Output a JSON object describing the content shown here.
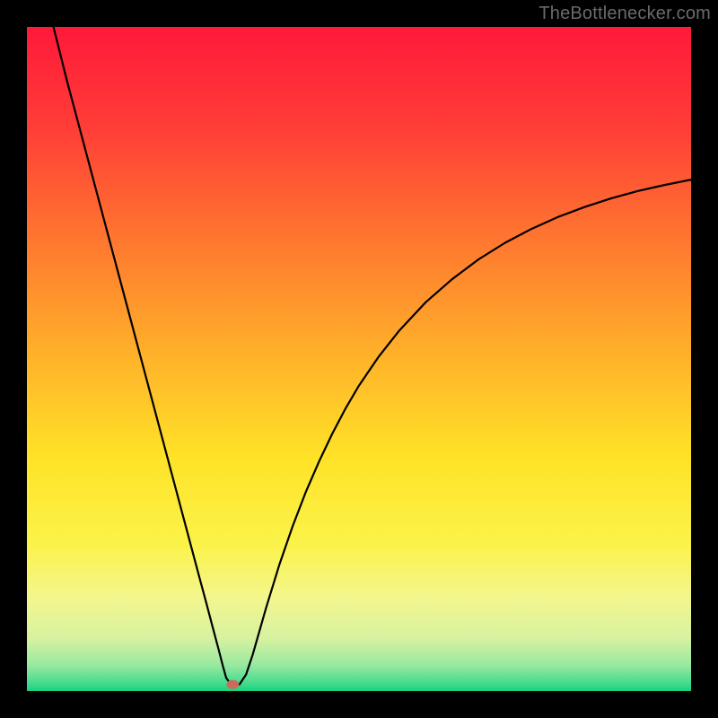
{
  "watermark": "TheBottlenecker.com",
  "chart_data": {
    "type": "line",
    "title": "",
    "xlabel": "",
    "ylabel": "",
    "xlim": [
      0,
      100
    ],
    "ylim": [
      0,
      100
    ],
    "x_min_at": 30,
    "marker": {
      "x": 31,
      "y": 1,
      "color": "#c96a5a",
      "rx": 7,
      "ry": 5
    },
    "grid": false,
    "legend": false,
    "background_gradient": {
      "stops": [
        {
          "offset": 0.0,
          "color": "#ff193a"
        },
        {
          "offset": 0.15,
          "color": "#ff3d37"
        },
        {
          "offset": 0.33,
          "color": "#ff7a2f"
        },
        {
          "offset": 0.5,
          "color": "#ffb329"
        },
        {
          "offset": 0.65,
          "color": "#ffe328"
        },
        {
          "offset": 0.78,
          "color": "#fbf34a"
        },
        {
          "offset": 0.86,
          "color": "#f3f68e"
        },
        {
          "offset": 0.92,
          "color": "#d7f2a0"
        },
        {
          "offset": 0.96,
          "color": "#9be9a0"
        },
        {
          "offset": 0.985,
          "color": "#4fdd90"
        },
        {
          "offset": 1.0,
          "color": "#17d37f"
        }
      ]
    },
    "series": [
      {
        "name": "bottleneck-curve",
        "color": "#000000",
        "width": 2.2,
        "x": [
          4,
          6,
          8,
          10,
          12,
          14,
          16,
          18,
          20,
          22,
          24,
          26,
          27,
          28,
          28.8,
          29.5,
          30,
          30.5,
          31.2,
          32,
          33,
          34,
          35,
          36,
          38,
          40,
          42,
          44,
          46,
          48,
          50,
          53,
          56,
          60,
          64,
          68,
          72,
          76,
          80,
          84,
          88,
          92,
          96,
          100
        ],
        "y": [
          100,
          92,
          84.5,
          77,
          69.5,
          62,
          54.5,
          47,
          39.5,
          32,
          24.5,
          17,
          13.3,
          9.5,
          6.5,
          3.8,
          2.0,
          1.3,
          1.0,
          1.0,
          2.5,
          5.5,
          9.0,
          12.5,
          19.0,
          24.8,
          30.0,
          34.6,
          38.8,
          42.6,
          46.0,
          50.4,
          54.2,
          58.5,
          62.0,
          65.0,
          67.5,
          69.6,
          71.4,
          72.9,
          74.2,
          75.3,
          76.2,
          77.0
        ]
      }
    ]
  }
}
